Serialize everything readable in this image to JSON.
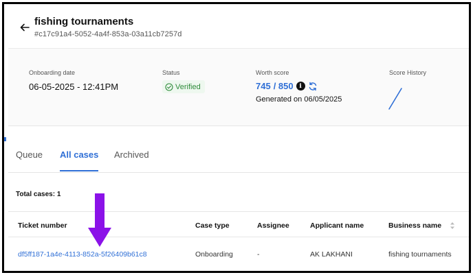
{
  "header": {
    "title": "fishing tournaments",
    "id": "#c17c91a4-5052-4a4f-853a-03a11cb7257d"
  },
  "info": {
    "onboarding_label": "Onboarding date",
    "onboarding_value": "06-05-2025 - 12:41PM",
    "status_label": "Status",
    "status_value": "Verified",
    "worth_label": "Worth score",
    "worth_score": "745",
    "worth_max": "/ 850",
    "generated": "Generated on 06/05/2025",
    "history_label": "Score History"
  },
  "tabs": [
    {
      "label": "Queue"
    },
    {
      "label": "All cases"
    },
    {
      "label": "Archived"
    }
  ],
  "total_cases": "Total cases: 1",
  "table": {
    "columns": [
      "Ticket number",
      "Case type",
      "Assignee",
      "Applicant name",
      "Business name"
    ],
    "rows": [
      [
        "df5ff187-1a4e-4113-852a-5f26409b61c8",
        "Onboarding",
        "-",
        "AK LAKHANI",
        "fishing tournaments"
      ]
    ]
  },
  "colors": {
    "accent": "#2f6fd6",
    "verified": "#2e8b3a",
    "annotation_arrow": "#8b12e8"
  },
  "icons": [
    "back-arrow-icon",
    "check-circle-icon",
    "info-icon",
    "refresh-icon",
    "sort-icon"
  ]
}
